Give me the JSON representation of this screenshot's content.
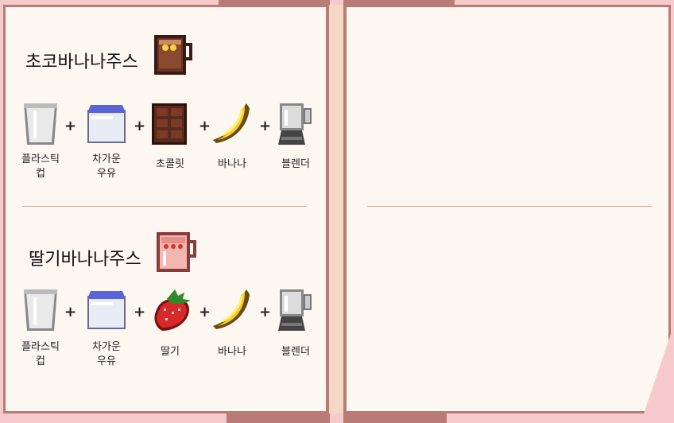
{
  "recipes": [
    {
      "title": "초코바나나주스",
      "cup_icon": "choco-banana-juice-icon",
      "ingredients": [
        {
          "label": "플라스틱\n컵",
          "icon": "plastic-cup-icon"
        },
        {
          "label": "차가운\n우유",
          "icon": "cold-milk-icon"
        },
        {
          "label": "초콜릿",
          "icon": "chocolate-icon"
        },
        {
          "label": "바나나",
          "icon": "banana-icon"
        },
        {
          "label": "블렌더",
          "icon": "blender-icon"
        }
      ]
    },
    {
      "title": "딸기바나나주스",
      "cup_icon": "strawberry-banana-juice-icon",
      "ingredients": [
        {
          "label": "플라스틱\n컵",
          "icon": "plastic-cup-icon"
        },
        {
          "label": "차가운\n우유",
          "icon": "cold-milk-icon"
        },
        {
          "label": "딸기",
          "icon": "strawberry-icon"
        },
        {
          "label": "바나나",
          "icon": "banana-icon"
        },
        {
          "label": "블렌더",
          "icon": "blender-icon"
        }
      ]
    }
  ],
  "plus_symbol": "+",
  "colors": {
    "page": "#fdf7f1",
    "border": "#b87b76",
    "background": "#f6c9cc",
    "spine": "#f3d8c4"
  }
}
